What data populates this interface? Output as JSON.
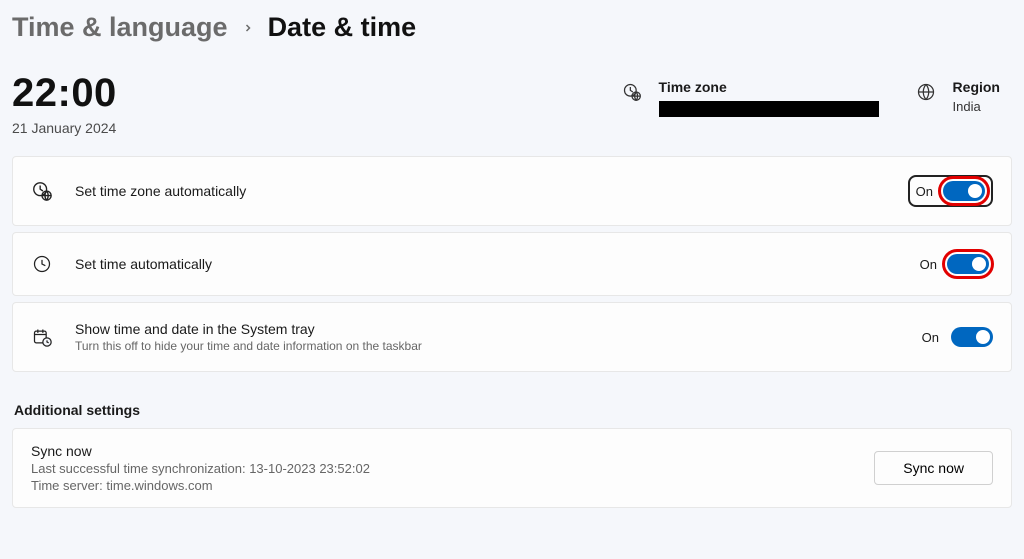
{
  "breadcrumb": {
    "parent": "Time & language",
    "current": "Date & time"
  },
  "header": {
    "time": "22:00",
    "date": "21 January 2024"
  },
  "timezone": {
    "label": "Time zone",
    "value_redacted": true
  },
  "region": {
    "label": "Region",
    "value": "India"
  },
  "settings": [
    {
      "title": "Set time zone automatically",
      "toggle_state": "On"
    },
    {
      "title": "Set time automatically",
      "toggle_state": "On"
    },
    {
      "title": "Show time and date in the System tray",
      "subtitle": "Turn this off to hide your time and date information on the taskbar",
      "toggle_state": "On"
    }
  ],
  "additional": {
    "heading": "Additional settings",
    "sync": {
      "title": "Sync now",
      "last_sync": "Last successful time synchronization: 13-10-2023 23:52:02",
      "server": "Time server: time.windows.com",
      "button": "Sync now"
    }
  }
}
